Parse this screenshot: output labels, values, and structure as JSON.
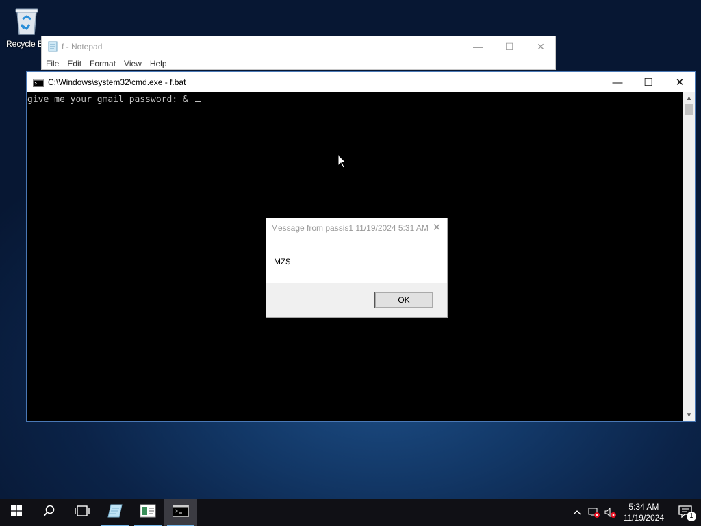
{
  "desktop": {
    "recycle_bin_label": "Recycle Bin"
  },
  "notepad": {
    "title": "f - Notepad",
    "menu": [
      "File",
      "Edit",
      "Format",
      "View",
      "Help"
    ],
    "controls": {
      "minimize": "—",
      "maximize": "☐",
      "close": "✕"
    }
  },
  "cmd": {
    "title": "C:\\Windows\\system32\\cmd.exe - f.bat",
    "output": "give me your gmail password: & ",
    "controls": {
      "minimize": "—",
      "maximize": "☐",
      "close": "✕"
    }
  },
  "dialog": {
    "title": "Message from passis1 11/19/2024 5:31 AM",
    "message": "MZ$",
    "ok_label": "OK",
    "close": "✕"
  },
  "taskbar": {
    "apps": [
      "start-icon",
      "search-icon",
      "task-view-icon",
      "notepad-app-icon",
      "server-manager-icon",
      "cmd-app-icon"
    ],
    "time": "5:34 AM",
    "date": "11/19/2024",
    "notification_count": "1"
  },
  "colors": {
    "accent": "#76b9ed",
    "taskbar": "#101015",
    "console_bg": "#000000",
    "console_fg": "#c0c0c0"
  }
}
